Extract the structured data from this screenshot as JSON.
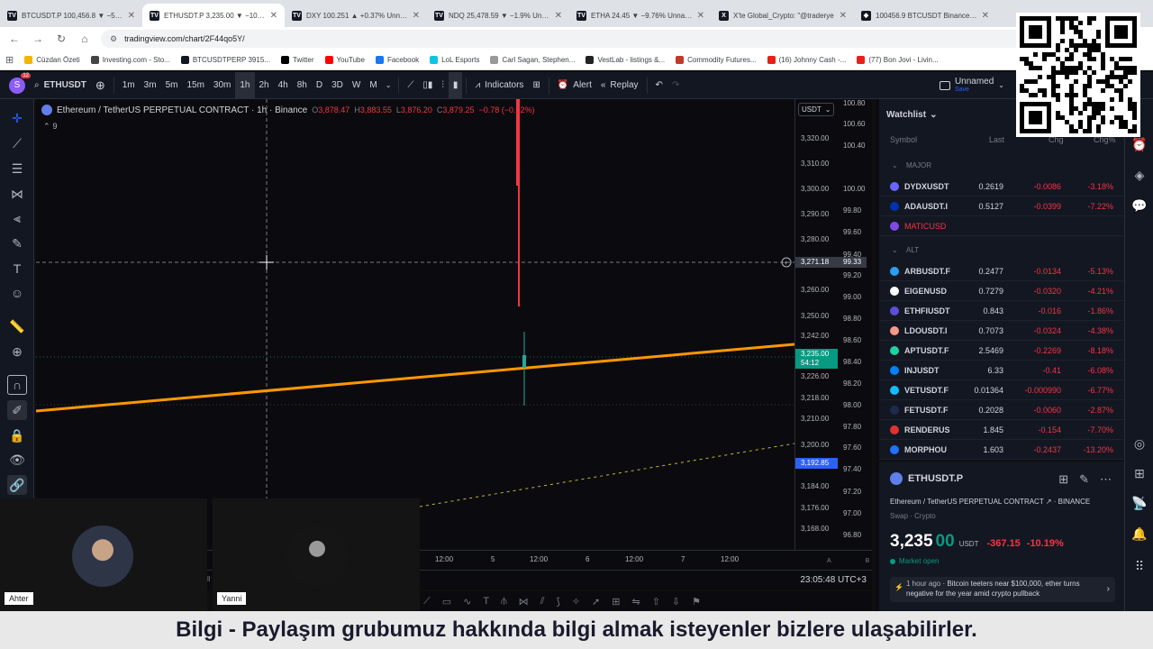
{
  "browser": {
    "tabs": [
      {
        "title": "BTCUSDT.P 100,456.8 ▼ −5.71%",
        "icon": "tradingview-icon"
      },
      {
        "title": "ETHUSDT.P 3,235.00 ▼ −10.19%",
        "icon": "tradingview-icon",
        "active": true
      },
      {
        "title": "DXY 100.251 ▲ +0.37% Unnamed",
        "icon": "tradingview-icon"
      },
      {
        "title": "NDQ 25,478.59 ▼ −1.9% Unnamed",
        "icon": "tradingview-icon"
      },
      {
        "title": "ETHA 24.45 ▼ −9.76% Unnamed",
        "icon": "tradingview-icon"
      },
      {
        "title": "X'te Global_Crypto: \"@traderye",
        "icon": "x-icon"
      },
      {
        "title": "100456.9 BTCUSDT Binance Bit",
        "icon": "binance-icon"
      }
    ],
    "url": "tradingview.com/chart/2F44qo5Y/",
    "bookmarks": [
      "Cüzdan Özeti",
      "Investing.com - Sto...",
      "BTCUSDTPERP 3915...",
      "Twitter",
      "YouTube",
      "Facebook",
      "LoL Esports",
      "Carl Sagan, Stephen...",
      "VestLab - listings &...",
      "Commodity Futures...",
      "(16) Johnny Cash -...",
      "(77) Bon Jovi - Livin..."
    ]
  },
  "toolbar": {
    "symbol": "ETHUSDT",
    "avatar_badge": "12",
    "intervals": [
      "1m",
      "3m",
      "5m",
      "15m",
      "30m",
      "1h",
      "2h",
      "4h",
      "8h",
      "D",
      "3D",
      "W",
      "M"
    ],
    "selected_interval": "1h",
    "indicators_label": "Indicators",
    "alert_label": "Alert",
    "replay_label": "Replay",
    "layout_name": "Unnamed",
    "layout_sub": "Save"
  },
  "chart": {
    "title": "Ethereum / TetherUS PERPETUAL CONTRACT · 1h · Binance",
    "ohlc": {
      "o_label": "O",
      "o": "3,878.47",
      "h_label": "H",
      "h": "3,883.55",
      "l_label": "L",
      "l": "3,876.20",
      "c_label": "C",
      "c": "3,879.25",
      "chg": "−0.78 (−0.02%)"
    },
    "indicator_count": "9",
    "currency": "USDT",
    "crosshair_price": "3,271.18",
    "crosshair_price2": "99.33",
    "last_price": "3,235.00",
    "countdown": "54:12",
    "line_price": "3,192.85",
    "clock": "23:05:48 UTC+3",
    "price_ticks": [
      "3,320.00",
      "3,310.00",
      "3,300.00",
      "3,290.00",
      "3,280.00",
      "3,260.00",
      "3,250.00",
      "3,242.00",
      "3,226.00",
      "3,218.00",
      "3,210.00",
      "3,200.00",
      "3,184.00",
      "3,176.00",
      "3,168.00"
    ],
    "secondary_ticks": [
      "100.80",
      "100.60",
      "100.40",
      "100.00",
      "99.80",
      "99.60",
      "99.40",
      "99.20",
      "99.00",
      "98.80",
      "98.60",
      "98.40",
      "98.20",
      "98.00",
      "97.80",
      "97.60",
      "97.40",
      "97.20",
      "97.00",
      "96.80"
    ],
    "time_labels": [
      "4",
      "12:00",
      "5",
      "12:00",
      "6",
      "12:00",
      "7",
      "12:00"
    ],
    "scale_buttons": [
      "A",
      "B"
    ]
  },
  "cameras": [
    {
      "name": "Ahter"
    },
    {
      "name": "Yanni"
    }
  ],
  "watchlist": {
    "title": "Watchlist",
    "columns": [
      "Symbol",
      "Last",
      "Chg",
      "Chg%"
    ],
    "sections": [
      {
        "name": "MAJOR",
        "rows": [
          {
            "symbol": "DYDXUSDT",
            "last": "0.2619",
            "chg": "-0.0086",
            "pct": "-3.18%",
            "color": "#6966ff"
          },
          {
            "symbol": "ADAUSDT.I",
            "last": "0.5127",
            "chg": "-0.0399",
            "pct": "-7.22%",
            "color": "#0033ad"
          },
          {
            "symbol": "MATICUSD",
            "last": "",
            "chg": "",
            "pct": "",
            "color": "#8247e5",
            "muted": true
          }
        ]
      },
      {
        "name": "ALT",
        "rows": [
          {
            "symbol": "ARBUSDT.F",
            "last": "0.2477",
            "chg": "-0.0134",
            "pct": "-5.13%",
            "color": "#28a0f0"
          },
          {
            "symbol": "EIGENUSD",
            "last": "0.7279",
            "chg": "-0.0320",
            "pct": "-4.21%",
            "color": "#ffffff"
          },
          {
            "symbol": "ETHFIUSDT",
            "last": "0.843",
            "chg": "-0.016",
            "pct": "-1.86%",
            "color": "#5b4fd8"
          },
          {
            "symbol": "LDOUSDT.I",
            "last": "0.7073",
            "chg": "-0.0324",
            "pct": "-4.38%",
            "color": "#f69988"
          },
          {
            "symbol": "APTUSDT.F",
            "last": "2.5469",
            "chg": "-0.2269",
            "pct": "-8.18%",
            "color": "#1fd1a5"
          },
          {
            "symbol": "INJUSDT",
            "last": "6.33",
            "chg": "-0.41",
            "pct": "-6.08%",
            "color": "#0082fa"
          },
          {
            "symbol": "VETUSDT.F",
            "last": "0.01364",
            "chg": "-0.000990",
            "pct": "-6.77%",
            "color": "#15bdff"
          },
          {
            "symbol": "FETUSDT.F",
            "last": "0.2028",
            "chg": "-0.0060",
            "pct": "-2.87%",
            "color": "#1d2b4d"
          },
          {
            "symbol": "RENDERUS",
            "last": "1.845",
            "chg": "-0.154",
            "pct": "-7.70%",
            "color": "#e0322f"
          },
          {
            "symbol": "MORPHOU",
            "last": "1.603",
            "chg": "-0.2437",
            "pct": "-13.20%",
            "color": "#2470ff"
          }
        ]
      }
    ]
  },
  "detail": {
    "symbol": "ETHUSDT.P",
    "name": "Ethereum / TetherUS PERPETUAL CONTRACT",
    "exchange": "BINANCE",
    "type": "Swap · Crypto",
    "price_main": "3,235",
    "price_dec": "00",
    "currency": "USDT",
    "change": "-367.15",
    "change_pct": "-10.19%",
    "market_status": "Market open",
    "news_time": "1 hour ago",
    "news_text": "Bitcoin teeters near $100,000, ether turns negative for the year amid crypto pullback"
  },
  "caption": "Bilgi - Paylaşım grubumuz hakkında bilgi almak isteyenler bizlere ulaşabilirler."
}
